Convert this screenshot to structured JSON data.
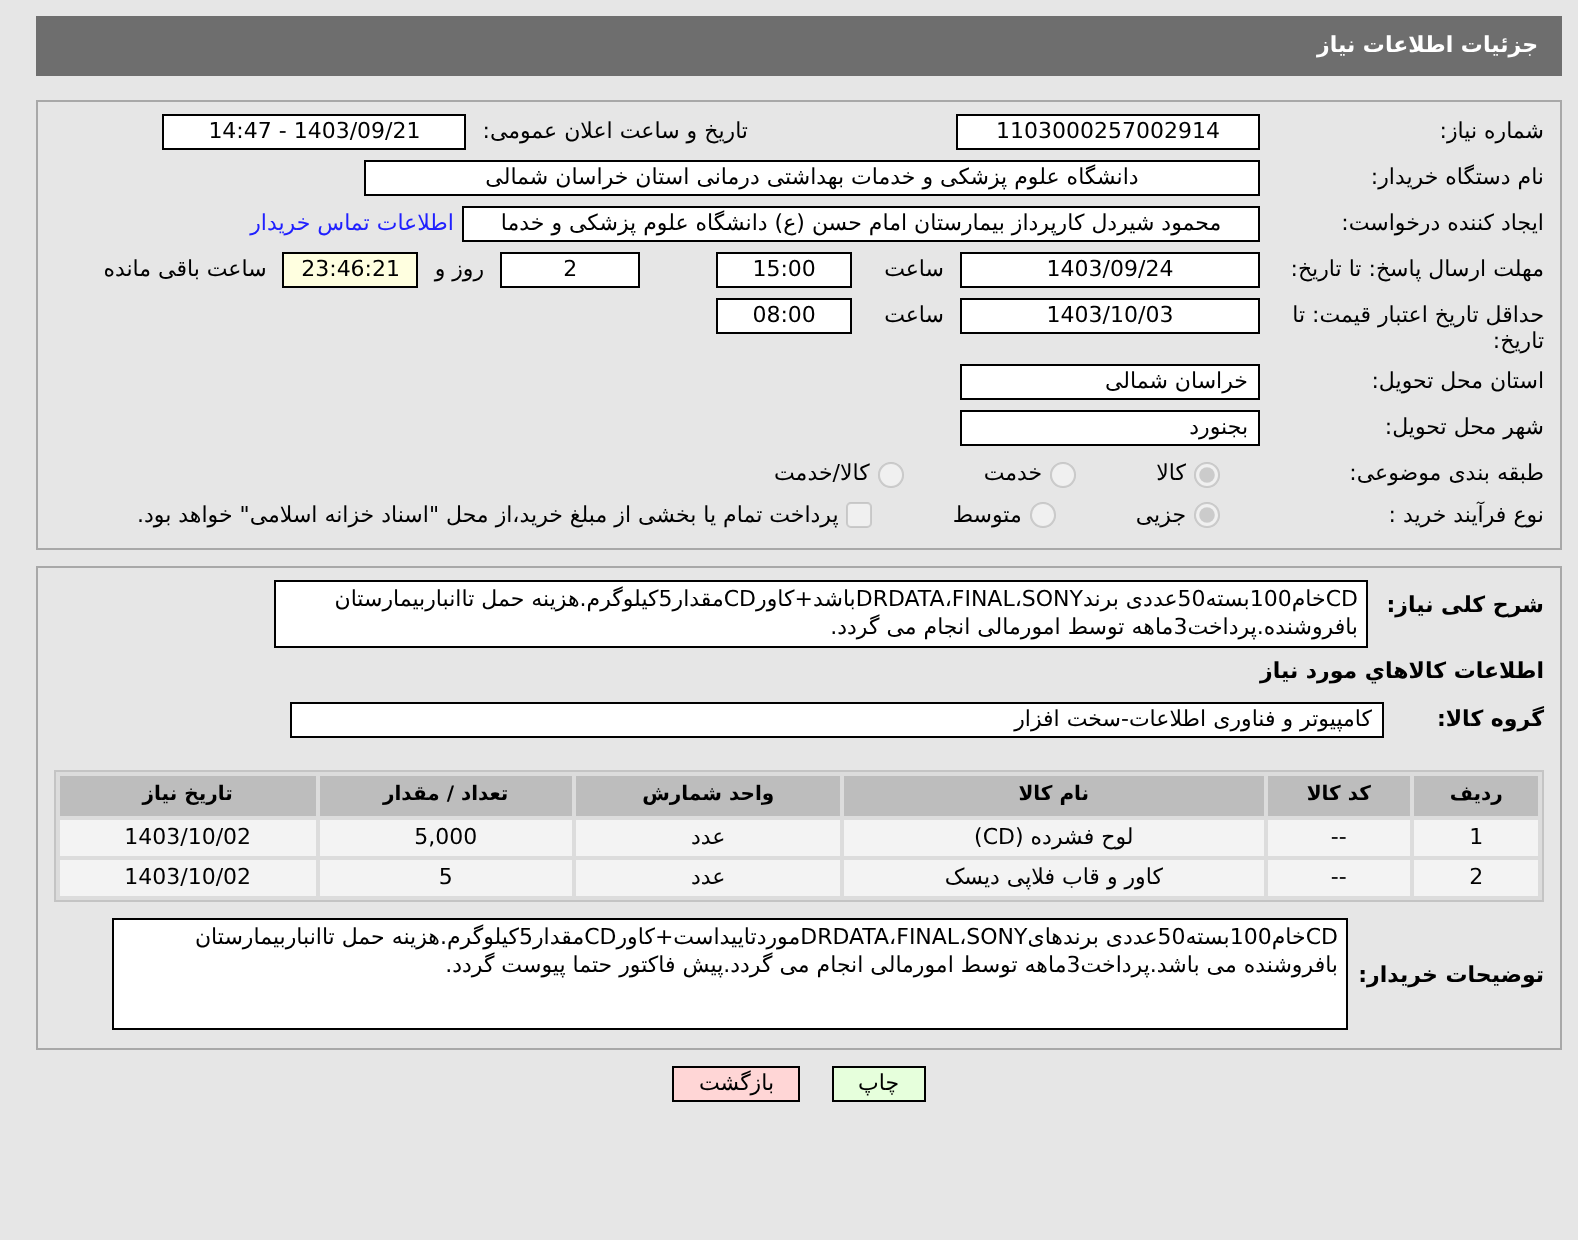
{
  "header": {
    "title": "جزئیات اطلاعات نیاز"
  },
  "rows": [
    {
      "kind": "pair",
      "label": "شماره نیاز:",
      "value": "1103000257002914",
      "label_2": "تاریخ و ساعت اعلان عمومی:",
      "value_2": "1403/09/21 - 14:47"
    },
    {
      "kind": "wide",
      "label": "نام دستگاه خریدار:",
      "value": "دانشگاه علوم پزشکی و خدمات بهداشتی درمانی استان خراسان شمالی"
    },
    {
      "kind": "link",
      "label": "ایجاد کننده درخواست:",
      "value": "محمود شیردل کارپرداز بیمارستان امام حسن (ع) دانشگاه علوم پزشکی و خدما",
      "link": "اطلاعات تماس خریدار"
    },
    {
      "kind": "deadline",
      "label": "مهلت ارسال پاسخ: تا تاریخ:",
      "date": "1403/09/24",
      "time_label": "ساعت",
      "time": "15:00",
      "days": "2",
      "days_label": "روز و",
      "remaining": "23:46:21",
      "remaining_label": "ساعت باقی مانده"
    },
    {
      "kind": "deadline",
      "label": "حداقل تاریخ اعتبار قیمت: تا تاریخ:",
      "date": "1403/10/03",
      "time_label": "ساعت",
      "time": "08:00"
    },
    {
      "kind": "field",
      "label": "استان محل تحویل:",
      "value": "خراسان شمالی"
    },
    {
      "kind": "field",
      "label": "شهر محل تحویل:",
      "value": "بجنورد"
    },
    {
      "kind": "radios",
      "label": "طبقه بندی موضوعی:",
      "options": [
        {
          "label": "کالا",
          "selected": true
        },
        {
          "label": "خدمت",
          "selected": false
        },
        {
          "label": "کالا/خدمت",
          "selected": false
        }
      ]
    },
    {
      "kind": "radios",
      "label": "نوع فرآیند خرید :",
      "options": [
        {
          "label": "جزیی",
          "selected": true
        },
        {
          "label": "متوسط",
          "selected": false
        }
      ],
      "checkbox": {
        "label": "پرداخت تمام یا بخشی از مبلغ خرید،از محل \"اسناد خزانه اسلامی\" خواهد بود.",
        "checked": false
      }
    }
  ],
  "summary": {
    "label": "شرح کلی نیاز:",
    "value": "CDخام100بسته50عددی برندDRDATA،FINAL،SONYباشد+کاورCDمقدار5کیلوگرم.هزینه حمل تاانباربیمارستان بافروشنده.پرداخت3ماهه توسط امورمالی انجام می گردد."
  },
  "goods_heading": "اطلاعات کالاهاي مورد نياز",
  "group": {
    "label": "گروه کالا:",
    "value": "کامپیوتر و فناوری اطلاعات-سخت افزار"
  },
  "table": {
    "columns": [
      "ردیف",
      "کد کالا",
      "نام کالا",
      "واحد شمارش",
      "تعداد / مقدار",
      "تاریخ نیاز"
    ],
    "rows": [
      [
        "1",
        "--",
        "لوح فشرده (CD)",
        "عدد",
        "5,000",
        "1403/10/02"
      ],
      [
        "2",
        "--",
        "کاور و قاب فلاپی دیسک",
        "عدد",
        "5",
        "1403/10/02"
      ]
    ]
  },
  "buyer_notes": {
    "label": "توضیحات خریدار:",
    "value": "CDخام100بسته50عددی برندهایDRDATA،FINAL،SONYموردتاییداست+کاورCDمقدار5کیلوگرم.هزینه حمل تاانباربیمارستان بافروشنده می باشد.پرداخت3ماهه توسط امورمالی انجام می گردد.پیش فاکتور حتما پیوست گردد."
  },
  "buttons": [
    {
      "kind": "print",
      "label": "چاپ"
    },
    {
      "kind": "back",
      "label": "بازگشت"
    }
  ]
}
